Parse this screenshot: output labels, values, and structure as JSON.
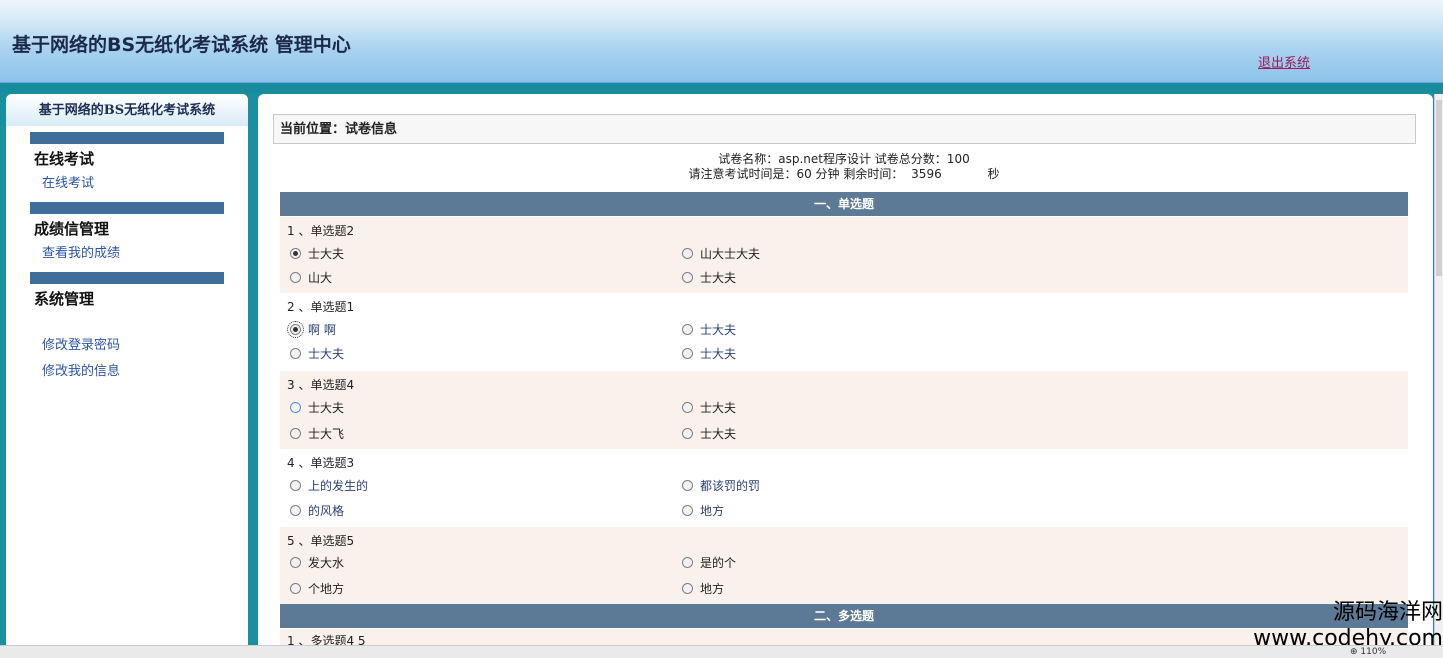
{
  "header": {
    "title": "基于网络的BS无纸化考试系统 管理中心",
    "logout": "退出系统"
  },
  "sidebar": {
    "title": "基于网络的BS无纸化考试系统",
    "sections": [
      {
        "title": "在线考试",
        "items": [
          "在线考试"
        ]
      },
      {
        "title": "成绩信管理",
        "items": [
          "查看我的成绩"
        ]
      },
      {
        "title": "系统管理",
        "items": [
          "修改登录密码",
          "修改我的信息"
        ]
      }
    ]
  },
  "main": {
    "breadcrumb": "当前位置：试卷信息",
    "paper_info": {
      "line1": "试卷名称：asp.net程序设计 试卷总分数：100",
      "line2_prefix": "请注意考试时间是：60 分钟 剩余时间：",
      "remaining": "3596",
      "unit": "秒"
    },
    "sections": [
      {
        "label": "一、单选题"
      },
      {
        "label": "二、多选题"
      }
    ],
    "questions": [
      {
        "title": "1 、单选题2",
        "options": [
          "士大夫",
          "山大士大夫",
          "山大",
          "士大夫"
        ],
        "checked": 0
      },
      {
        "title": "2 、单选题1",
        "options": [
          "啊 啊",
          "士大夫",
          "士大夫",
          "士大夫"
        ],
        "checked": 0
      },
      {
        "title": "3 、单选题4",
        "options": [
          "士大夫",
          "士大夫",
          "士大飞",
          "士大夫"
        ],
        "checked": -1
      },
      {
        "title": "4 、单选题3",
        "options": [
          "上的发生的",
          "都该罚的罚",
          "的风格",
          "地方"
        ],
        "checked": -1
      },
      {
        "title": "5 、单选题5",
        "options": [
          "发大水",
          "是的个",
          "个地方",
          "地方"
        ],
        "checked": -1
      },
      {
        "title": "1 、多选题4 5",
        "options": [],
        "checked": -1
      }
    ]
  },
  "watermark": {
    "line1": "源码海洋网",
    "line2": "www.codehy.com"
  },
  "status": {
    "zoom": "110%"
  }
}
